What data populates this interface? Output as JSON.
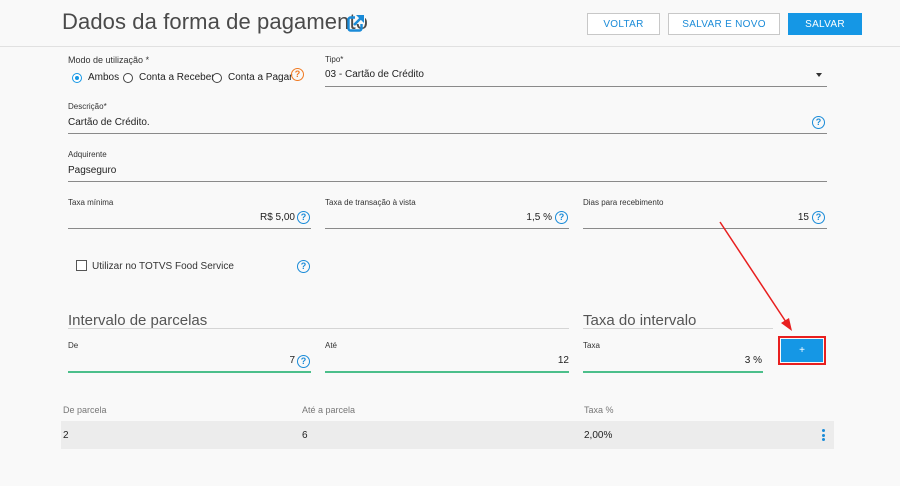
{
  "header": {
    "title": "Dados da forma de pagamento",
    "back_label": "VOLTAR",
    "save_new_label": "SALVAR E NOVO",
    "save_label": "SALVAR"
  },
  "usage_mode": {
    "label": "Modo de utilização",
    "required_mark": "*",
    "options": [
      "Ambos",
      "Conta a Receber",
      "Conta a Pagar"
    ],
    "selected": "Ambos"
  },
  "type": {
    "label": "Tipo",
    "required_mark": "*",
    "value": "03 - Cartão de Crédito"
  },
  "description": {
    "label": "Descrição",
    "required_mark": "*",
    "value": "Cartão de Crédito."
  },
  "acquirer": {
    "label": "Adquirente",
    "value": "Pagseguro"
  },
  "min_fee": {
    "label": "Taxa mínima",
    "value": "R$ 5,00"
  },
  "cash_fee": {
    "label": "Taxa de transação à vista",
    "value": "1,5 %"
  },
  "receive_days": {
    "label": "Dias para recebimento",
    "value": "15"
  },
  "food_service": {
    "label": "Utilizar no TOTVS Food Service",
    "checked": false
  },
  "installments": {
    "title": "Intervalo de parcelas",
    "from_label": "De",
    "from_value": "7",
    "to_label": "Até",
    "to_value": "12"
  },
  "interval_fee": {
    "title": "Taxa do intervalo",
    "label": "Taxa",
    "value": "3 %",
    "add_label": "+"
  },
  "table": {
    "columns": [
      "De parcela",
      "Até a parcela",
      "Taxa %"
    ],
    "rows": [
      [
        "2",
        "6",
        "2,00%"
      ]
    ]
  },
  "colors": {
    "primary": "#1597e5",
    "accent_green": "#4cbf8b",
    "highlight_red": "#e81f1f",
    "help_orange": "#f07a22"
  },
  "icons": {
    "title": "external-link-icon",
    "help": "question-circle-icon",
    "row_menu": "kebab-menu-icon",
    "select": "caret-down-icon"
  }
}
